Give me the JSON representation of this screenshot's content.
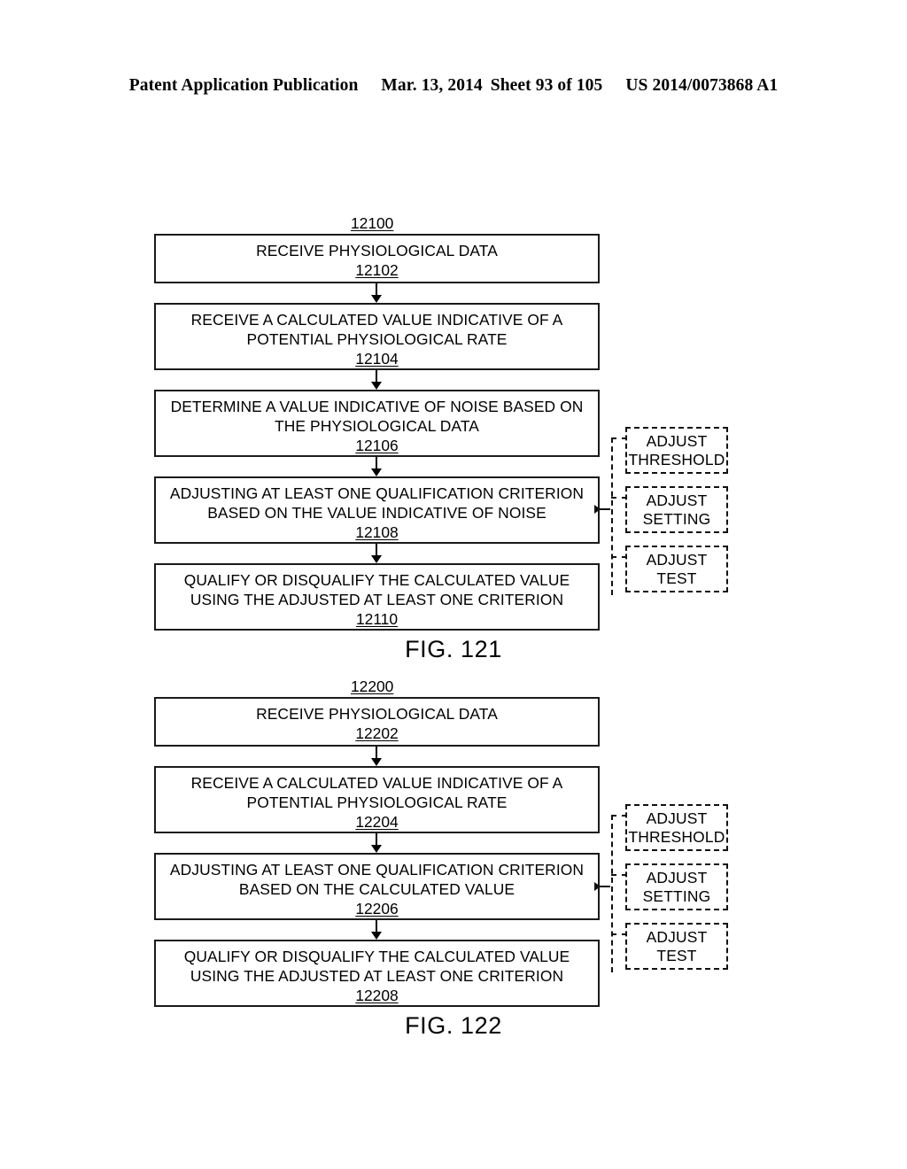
{
  "header": {
    "publication": "Patent Application Publication",
    "date": "Mar. 13, 2014",
    "sheet": "Sheet 93 of 105",
    "patent_number": "US 2014/0073868 A1"
  },
  "figures": [
    {
      "caption": "FIG. 121",
      "top_ref": "12100",
      "steps": [
        {
          "lines": [
            "RECEIVE PHYSIOLOGICAL DATA"
          ],
          "ref": "12102"
        },
        {
          "lines": [
            "RECEIVE A CALCULATED VALUE INDICATIVE OF A",
            "POTENTIAL PHYSIOLOGICAL RATE"
          ],
          "ref": "12104"
        },
        {
          "lines": [
            "DETERMINE A VALUE INDICATIVE OF NOISE BASED ON",
            "THE PHYSIOLOGICAL DATA"
          ],
          "ref": "12106"
        },
        {
          "lines": [
            "ADJUSTING AT LEAST ONE QUALIFICATION CRITERION",
            "BASED ON THE VALUE INDICATIVE OF NOISE"
          ],
          "ref": "12108"
        },
        {
          "lines": [
            "QUALIFY OR DISQUALIFY THE CALCULATED VALUE",
            "USING THE ADJUSTED AT LEAST ONE CRITERION"
          ],
          "ref": "12110"
        }
      ],
      "options": [
        {
          "lines": [
            "ADJUST",
            "THRESHOLD"
          ]
        },
        {
          "lines": [
            "ADJUST",
            "SETTING"
          ]
        },
        {
          "lines": [
            "ADJUST",
            "TEST"
          ]
        }
      ]
    },
    {
      "caption": "FIG. 122",
      "top_ref": "12200",
      "steps": [
        {
          "lines": [
            "RECEIVE PHYSIOLOGICAL DATA"
          ],
          "ref": "12202"
        },
        {
          "lines": [
            "RECEIVE A CALCULATED VALUE INDICATIVE OF A",
            "POTENTIAL PHYSIOLOGICAL RATE"
          ],
          "ref": "12204"
        },
        {
          "lines": [
            "ADJUSTING AT LEAST ONE QUALIFICATION CRITERION",
            "BASED ON THE CALCULATED VALUE"
          ],
          "ref": "12206"
        },
        {
          "lines": [
            "QUALIFY OR DISQUALIFY THE CALCULATED VALUE",
            "USING THE ADJUSTED AT LEAST ONE CRITERION"
          ],
          "ref": "12208"
        }
      ],
      "options": [
        {
          "lines": [
            "ADJUST",
            "THRESHOLD"
          ]
        },
        {
          "lines": [
            "ADJUST",
            "SETTING"
          ]
        },
        {
          "lines": [
            "ADJUST",
            "TEST"
          ]
        }
      ]
    }
  ],
  "colors": {
    "ink": "#000000",
    "paper": "#ffffff"
  }
}
